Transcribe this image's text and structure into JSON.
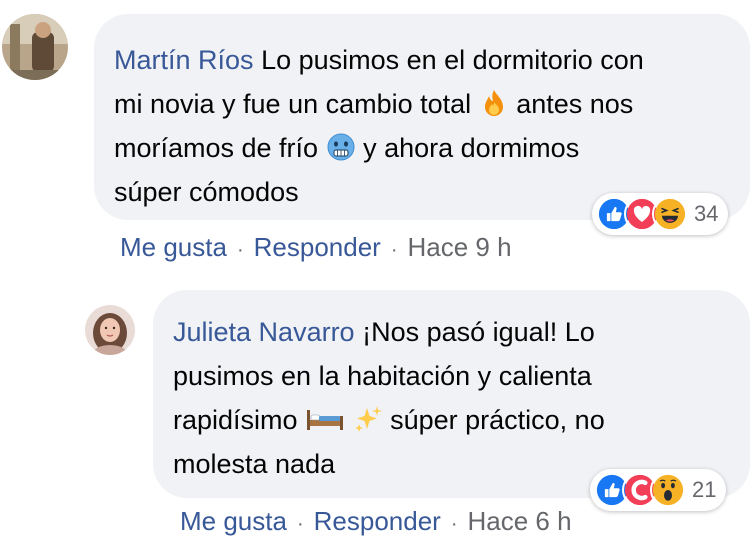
{
  "comments": [
    {
      "author": "Martín Ríos",
      "text_parts": [
        "Lo pusimos en el dormitorio con",
        "mi novia y fue un cambio total",
        "antes nos",
        "moríamos de frío",
        "y ahora dormimos",
        "súper cómodos"
      ],
      "emojis": [
        "fire-icon",
        "cold-face-icon"
      ],
      "reactions": [
        "like-icon",
        "love-icon",
        "haha-icon"
      ],
      "reaction_count": "34",
      "actions": {
        "like": "Me gusta",
        "reply": "Responder",
        "time": "Hace 9 h"
      }
    },
    {
      "author": "Julieta Navarro",
      "text_parts": [
        "¡Nos pasó igual! Lo",
        "pusimos en la habitación y calienta",
        "rapidísimo",
        "súper práctico, no",
        "molesta nada"
      ],
      "emojis": [
        "bed-icon",
        "sparkles-icon"
      ],
      "reactions": [
        "like-icon",
        "care-icon",
        "wow-icon"
      ],
      "reaction_count": "21",
      "actions": {
        "like": "Me gusta",
        "reply": "Responder",
        "time": "Hace 6 h"
      }
    }
  ],
  "colors": {
    "bubble": "#f0f2f5",
    "author": "#385898",
    "meta": "#65676b",
    "like": "#1877f2",
    "love": "#f33e58",
    "reaction_yellow": "#f7b125"
  }
}
